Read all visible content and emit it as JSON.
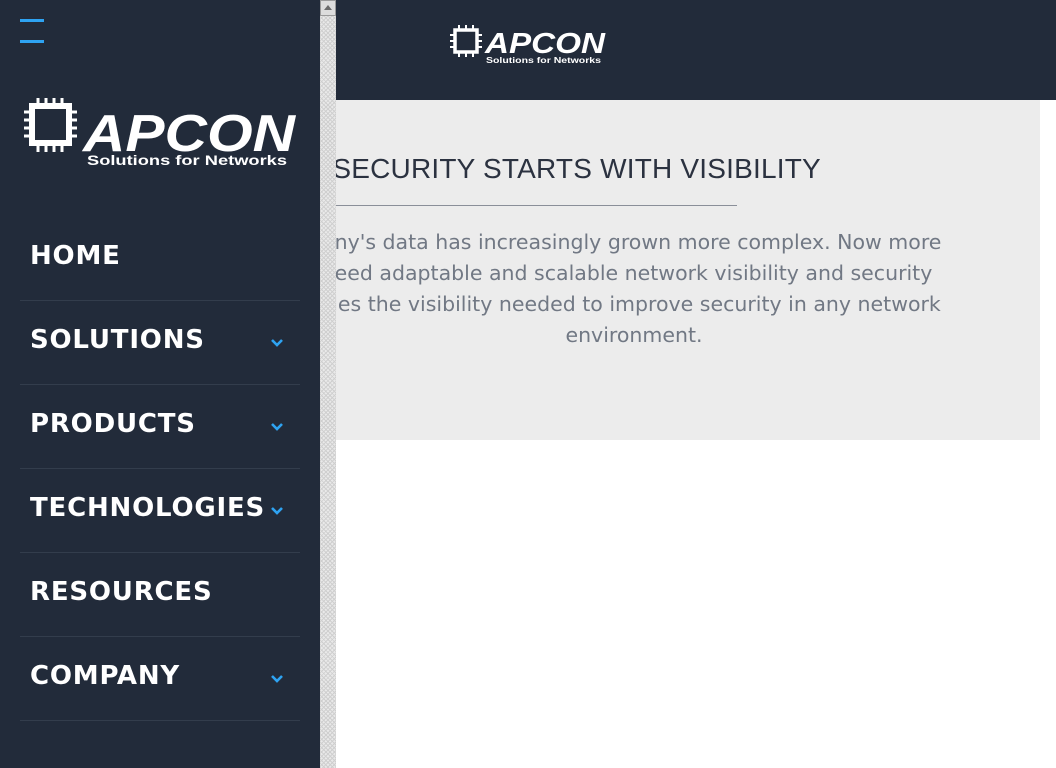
{
  "header": {
    "logo": {
      "brand": "APCON",
      "tagline": "Solutions for Networks",
      "icon": "chip-logo-icon"
    }
  },
  "hero": {
    "title": "RK SECURITY STARTS WITH VISIBILITY",
    "body_lines": [
      "ny's data has increasingly grown more complex. Now more",
      "need adaptable and scalable network visibility and security",
      "ides the visibility needed to improve security in any network",
      "environment."
    ]
  },
  "drawer": {
    "menu_icon": "hamburger-icon",
    "logo": {
      "brand": "APCON",
      "tagline": "Solutions for Networks",
      "icon": "chip-logo-icon"
    },
    "items": [
      {
        "label": "HOME",
        "has_submenu": false
      },
      {
        "label": "SOLUTIONS",
        "has_submenu": true
      },
      {
        "label": "PRODUCTS",
        "has_submenu": true
      },
      {
        "label": "TECHNOLOGIES",
        "has_submenu": true
      },
      {
        "label": "RESOURCES",
        "has_submenu": false
      },
      {
        "label": "COMPANY",
        "has_submenu": true
      }
    ]
  },
  "colors": {
    "navy": "#222b3a",
    "accent": "#2ea3f2",
    "hero_bg": "#ececec",
    "title_text": "#2b3240",
    "body_text": "#717884"
  }
}
